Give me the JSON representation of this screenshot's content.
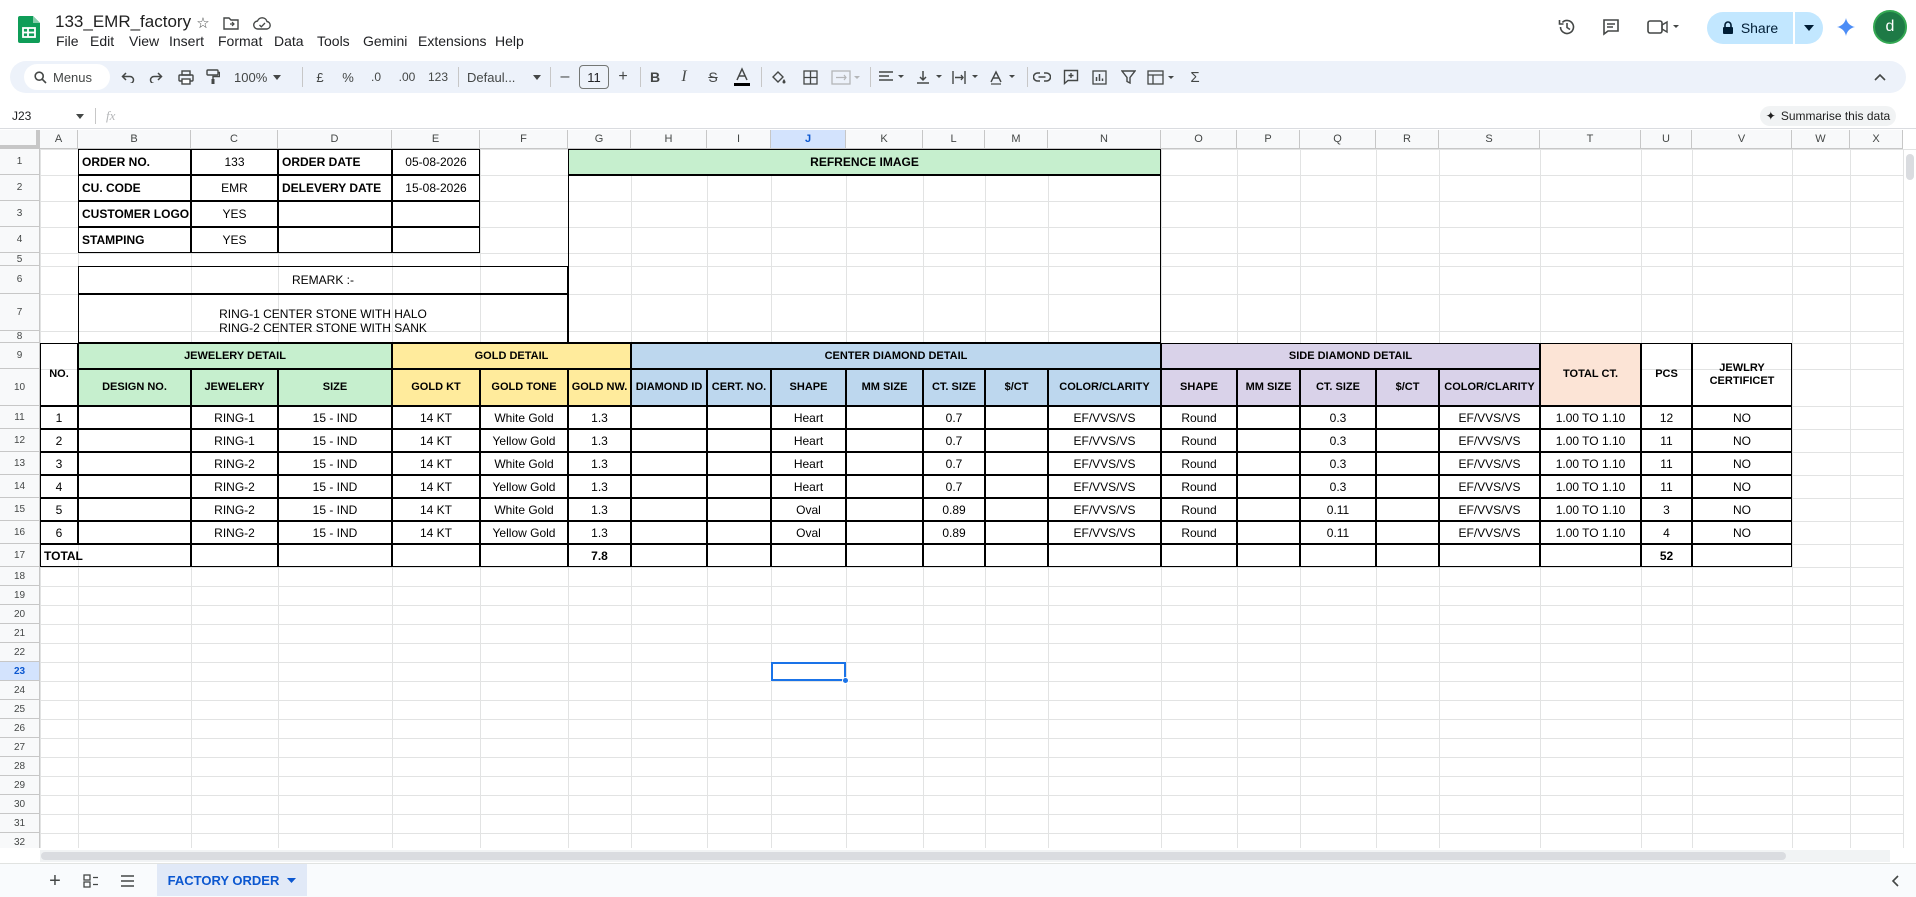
{
  "doc": {
    "title": "133_EMR_factory"
  },
  "menus": [
    "File",
    "Edit",
    "View",
    "Insert",
    "Format",
    "Data",
    "Tools",
    "Gemini",
    "Extensions",
    "Help"
  ],
  "header": {
    "share_label": "Share",
    "avatar_letter": "d"
  },
  "toolbar": {
    "search_label": "Menus",
    "zoom": "100%",
    "currency": "£",
    "percent": "%",
    "dec_less": ".0",
    "dec_more": ".00",
    "num_format": "123",
    "font": "Defaul...",
    "font_size": "11"
  },
  "formula_bar": {
    "cell_ref": "J23",
    "fx": "fx",
    "value": "",
    "summarise_label": "Summarise this data"
  },
  "columns": [
    "A",
    "B",
    "C",
    "D",
    "E",
    "F",
    "G",
    "H",
    "I",
    "J",
    "K",
    "L",
    "M",
    "N",
    "O",
    "P",
    "Q",
    "R",
    "S",
    "T",
    "U",
    "V",
    "W",
    "X"
  ],
  "rows": [
    "1",
    "2",
    "3",
    "4",
    "5",
    "6",
    "7",
    "8",
    "9",
    "10",
    "11",
    "12",
    "13",
    "14",
    "15",
    "16",
    "17",
    "18",
    "19",
    "20",
    "21",
    "22",
    "23",
    "24",
    "25",
    "26",
    "27",
    "28",
    "29",
    "30",
    "31",
    "32"
  ],
  "selected": {
    "column": "J",
    "row": "23"
  },
  "order": {
    "order_no_label": "ORDER NO.",
    "order_no": "133",
    "order_date_label": "ORDER DATE",
    "order_date": "05-08-2026",
    "cu_code_label": "CU. CODE",
    "cu_code": "EMR",
    "delivery_date_label": "DELEVERY DATE",
    "delivery_date": "15-08-2026",
    "logo_label": "CUSTOMER LOGO",
    "logo": "YES",
    "stamping_label": "STAMPING",
    "stamping": "YES"
  },
  "remark": {
    "label": "REMARK :-",
    "text": "RING-1  CENTER STONE WITH HALO\nRING-2 CENTER STONE WITH SANK"
  },
  "reference_image_label": "REFRENCE IMAGE",
  "groups": {
    "jewelery": "JEWELERY DETAIL",
    "gold": "GOLD DETAIL",
    "center": "CENTER DIAMOND DETAIL",
    "side": "SIDE DIAMOND DETAIL"
  },
  "table_headers": [
    "NO.",
    "DESIGN NO.",
    "JEWELERY",
    "SIZE",
    "GOLD KT",
    "GOLD TONE",
    "GOLD NW.",
    "DIAMOND ID",
    "CERT. NO.",
    "SHAPE",
    "MM SIZE",
    "CT. SIZE",
    "$/CT",
    "COLOR/CLARITY",
    "SHAPE",
    "MM SIZE",
    "CT. SIZE",
    "$/CT",
    "COLOR/CLARITY",
    "TOTAL CT.",
    "PCS",
    "JEWLRY\nCERTIFICET"
  ],
  "table_rows": [
    [
      "1",
      "",
      "RING-1",
      "15 - IND",
      "14 KT",
      "White Gold",
      "1.3",
      "",
      "",
      "Heart",
      "",
      "0.7",
      "",
      "EF/VVS/VS",
      "Round",
      "",
      "0.3",
      "",
      "EF/VVS/VS",
      "1.00 TO 1.10",
      "12",
      "NO"
    ],
    [
      "2",
      "",
      "RING-1",
      "15 - IND",
      "14 KT",
      "Yellow Gold",
      "1.3",
      "",
      "",
      "Heart",
      "",
      "0.7",
      "",
      "EF/VVS/VS",
      "Round",
      "",
      "0.3",
      "",
      "EF/VVS/VS",
      "1.00 TO 1.10",
      "11",
      "NO"
    ],
    [
      "3",
      "",
      "RING-2",
      "15 - IND",
      "14 KT",
      "White Gold",
      "1.3",
      "",
      "",
      "Heart",
      "",
      "0.7",
      "",
      "EF/VVS/VS",
      "Round",
      "",
      "0.3",
      "",
      "EF/VVS/VS",
      "1.00 TO 1.10",
      "11",
      "NO"
    ],
    [
      "4",
      "",
      "RING-2",
      "15 - IND",
      "14 KT",
      "Yellow Gold",
      "1.3",
      "",
      "",
      "Heart",
      "",
      "0.7",
      "",
      "EF/VVS/VS",
      "Round",
      "",
      "0.3",
      "",
      "EF/VVS/VS",
      "1.00 TO 1.10",
      "11",
      "NO"
    ],
    [
      "5",
      "",
      "RING-2",
      "15 - IND",
      "14 KT",
      "White Gold",
      "1.3",
      "",
      "",
      "Oval",
      "",
      "0.89",
      "",
      "EF/VVS/VS",
      "Round",
      "",
      "0.11",
      "",
      "EF/VVS/VS",
      "1.00 TO 1.10",
      "3",
      "NO"
    ],
    [
      "6",
      "",
      "RING-2",
      "15 - IND",
      "14 KT",
      "Yellow Gold",
      "1.3",
      "",
      "",
      "Oval",
      "",
      "0.89",
      "",
      "EF/VVS/VS",
      "Round",
      "",
      "0.11",
      "",
      "EF/VVS/VS",
      "1.00 TO 1.10",
      "4",
      "NO"
    ]
  ],
  "totals": {
    "label": "TOTAL",
    "gold_nw": "7.8",
    "pcs": "52"
  },
  "sheet_tab": {
    "name": "FACTORY ORDER"
  },
  "colors": {
    "green": "#c6efce",
    "yellow": "#ffeb9c",
    "blue": "#bdd7ee",
    "purple": "#d9d2e9",
    "peach": "#fce4d6",
    "accent": "#1a73e8",
    "share_bg": "#c2e7ff"
  }
}
